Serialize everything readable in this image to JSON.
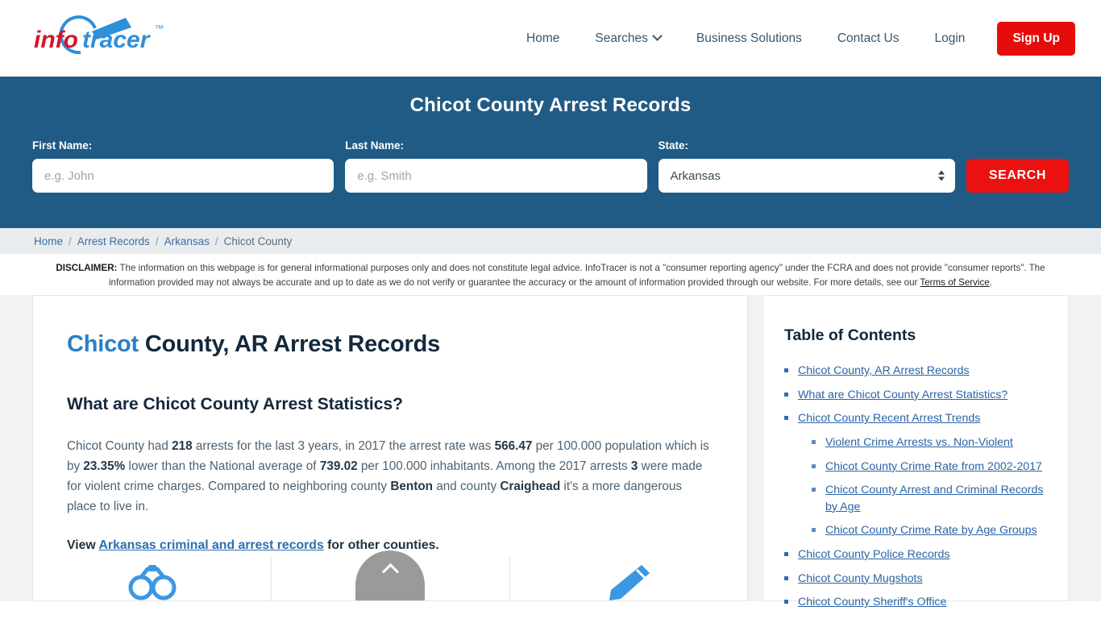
{
  "brand": {
    "name_part1": "info",
    "name_part2": "tracer",
    "trademark": "™",
    "color_red": "#d3162a",
    "color_blue": "#2e90d8"
  },
  "nav": {
    "items": [
      {
        "label": "Home",
        "has_caret": false
      },
      {
        "label": "Searches",
        "has_caret": true
      },
      {
        "label": "Business Solutions",
        "has_caret": false
      },
      {
        "label": "Contact Us",
        "has_caret": false
      },
      {
        "label": "Login",
        "has_caret": false
      }
    ],
    "signup_label": "Sign Up"
  },
  "search_band": {
    "title": "Chicot County Arrest Records",
    "first_name": {
      "label": "First Name:",
      "placeholder": "e.g. John",
      "value": ""
    },
    "last_name": {
      "label": "Last Name:",
      "placeholder": "e.g. Smith",
      "value": ""
    },
    "state": {
      "label": "State:",
      "selected": "Arkansas"
    },
    "search_button": "SEARCH",
    "background_color": "#205b85",
    "button_color": "#ec1111"
  },
  "breadcrumb": {
    "items": [
      "Home",
      "Arrest Records",
      "Arkansas"
    ],
    "current": "Chicot County",
    "separator": "/"
  },
  "disclaimer": {
    "label": "DISCLAIMER:",
    "text_part1": " The information on this webpage is for general informational purposes only and does not constitute legal advice. InfoTracer is not a \"consumer reporting agency\" under the FCRA and does not provide \"consumer reports\". The information provided may not always be accurate and up to date as we do not verify or guarantee the accuracy or the amount of information provided through our website. For more details, see our ",
    "link_text": "Terms of Service",
    "text_part2": "."
  },
  "main": {
    "title_highlight": "Chicot",
    "title_rest": " County, AR Arrest Records",
    "subtitle": "What are Chicot County Arrest Statistics?",
    "paragraph": {
      "s1": "Chicot County had ",
      "b1": "218",
      "s2": " arrests for the last 3 years, in 2017 the arrest rate was ",
      "b2": "566.47",
      "s3": " per 100.000 population which is by ",
      "b3": "23.35%",
      "s4": " lower than the National average of ",
      "b4": "739.02",
      "s5": " per 100.000 inhabitants. Among the 2017 arrests ",
      "b5": "3",
      "s6": " were made for violent crime charges. Compared to neighboring county ",
      "b6": "Benton",
      "s7": " and county ",
      "b7": "Craighead",
      "s8": " it's a more dangerous place to live in."
    },
    "view_line": {
      "prefix": "View ",
      "link": "Arkansas criminal and arrest records",
      "suffix": " for other counties."
    },
    "icons": [
      "handcuffs-icon",
      "trending-up-icon",
      "pen-icon"
    ]
  },
  "toc": {
    "heading": "Table of Contents",
    "items": [
      {
        "label": "Chicot County, AR Arrest Records",
        "children": []
      },
      {
        "label": "What are Chicot County Arrest Statistics?",
        "children": []
      },
      {
        "label": "Chicot County Recent Arrest Trends",
        "children": [
          {
            "label": "Violent Crime Arrests vs. Non-Violent"
          },
          {
            "label": "Chicot County Crime Rate from 2002-2017"
          },
          {
            "label": "Chicot County Arrest and Criminal Records by Age"
          },
          {
            "label": "Chicot County Crime Rate by Age Groups"
          }
        ]
      },
      {
        "label": "Chicot County Police Records",
        "children": []
      },
      {
        "label": "Chicot County Mugshots",
        "children": []
      },
      {
        "label": "Chicot County Sheriff's Office",
        "children": []
      }
    ]
  },
  "scroll_top": {
    "icon": "chevron-up-icon",
    "color": "#9a9a9a"
  }
}
